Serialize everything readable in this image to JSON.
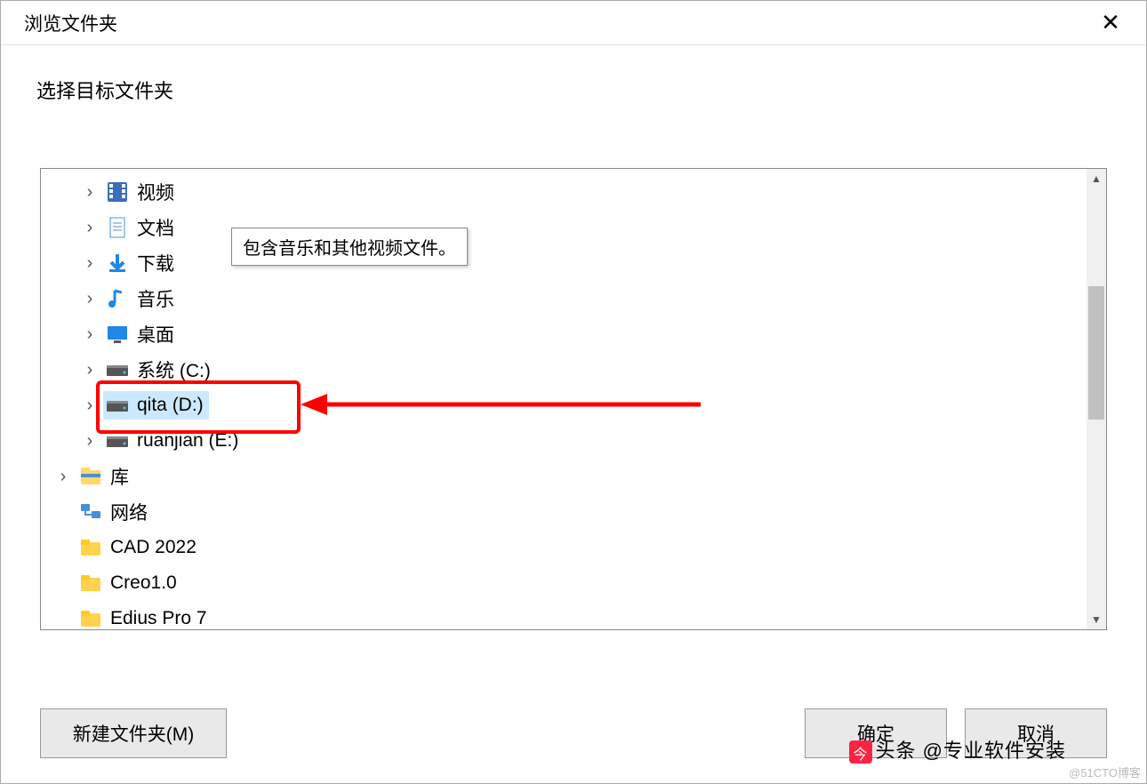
{
  "dialog": {
    "title": "浏览文件夹",
    "instruction": "选择目标文件夹",
    "tooltip_text": "包含音乐和其他视频文件。"
  },
  "tree": {
    "items": [
      {
        "label": "视频",
        "icon": "video-icon",
        "indent": 1,
        "expandable": true,
        "selected": false
      },
      {
        "label": "文档",
        "icon": "document-icon",
        "indent": 1,
        "expandable": true,
        "selected": false
      },
      {
        "label": "下载",
        "icon": "download-icon",
        "indent": 1,
        "expandable": true,
        "selected": false
      },
      {
        "label": "音乐",
        "icon": "music-icon",
        "indent": 1,
        "expandable": true,
        "selected": false
      },
      {
        "label": "桌面",
        "icon": "desktop-icon",
        "indent": 1,
        "expandable": true,
        "selected": false
      },
      {
        "label": "系统 (C:)",
        "icon": "drive-icon",
        "indent": 1,
        "expandable": true,
        "selected": false
      },
      {
        "label": "qita (D:)",
        "icon": "drive-icon",
        "indent": 1,
        "expandable": true,
        "selected": true
      },
      {
        "label": "ruanjian (E:)",
        "icon": "drive-icon",
        "indent": 1,
        "expandable": true,
        "selected": false
      },
      {
        "label": "库",
        "icon": "libraries-icon",
        "indent": 2,
        "expandable": true,
        "selected": false
      },
      {
        "label": "网络",
        "icon": "network-icon",
        "indent": 2,
        "expandable": false,
        "selected": false
      },
      {
        "label": "CAD 2022",
        "icon": "folder-icon",
        "indent": 2,
        "expandable": false,
        "selected": false
      },
      {
        "label": "Creo1.0",
        "icon": "folder-icon",
        "indent": 2,
        "expandable": false,
        "selected": false
      },
      {
        "label": "Edius Pro 7",
        "icon": "folder-icon",
        "indent": 2,
        "expandable": false,
        "selected": false
      }
    ]
  },
  "buttons": {
    "new_folder": "新建文件夹(M)",
    "ok": "确定",
    "cancel": "取消"
  },
  "watermarks": {
    "toutiao": "头条 @专业软件安装",
    "cto": "@51CTO博客"
  }
}
